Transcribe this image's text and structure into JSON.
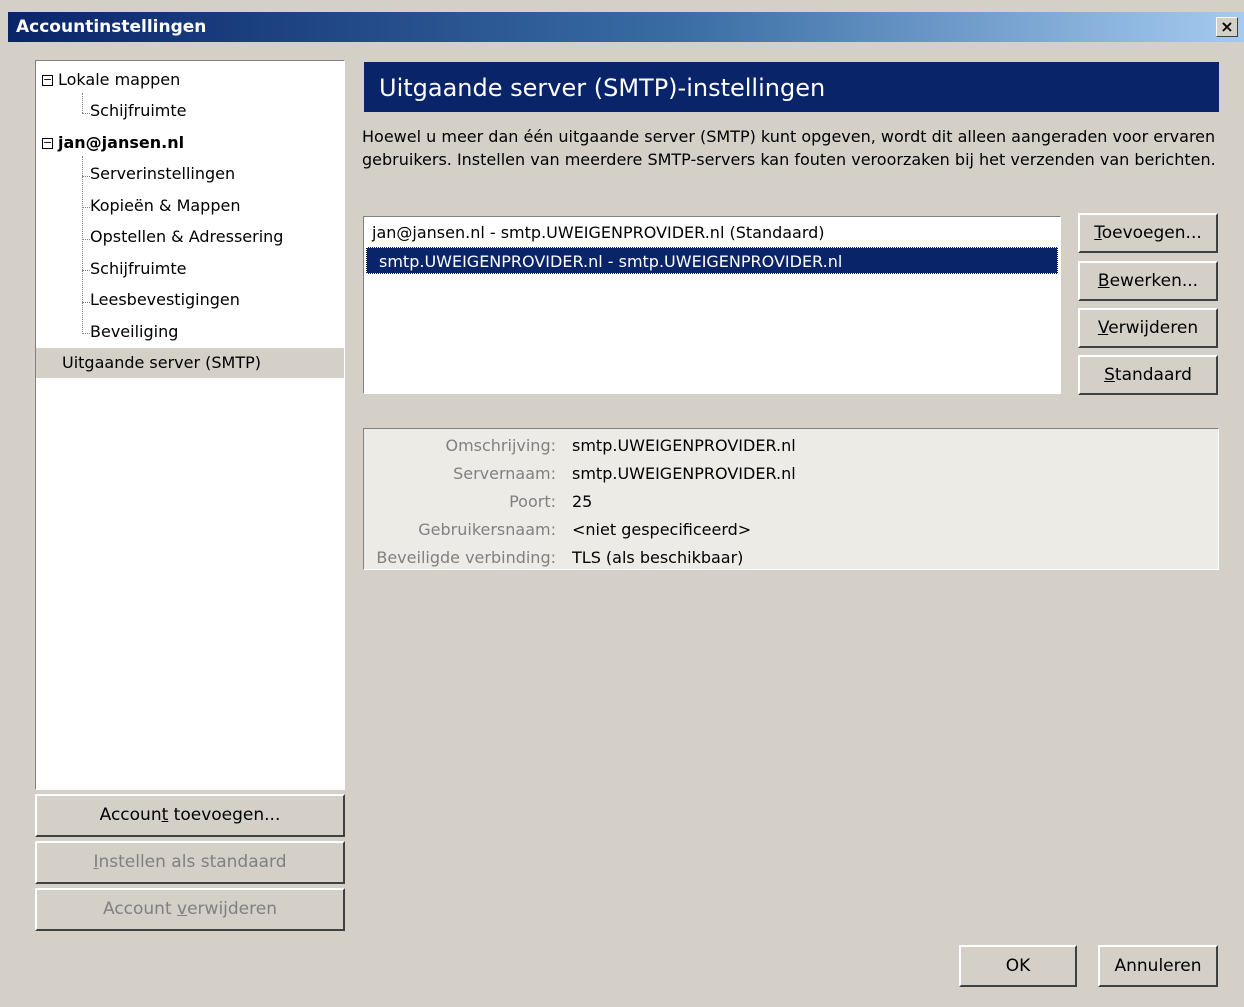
{
  "window": {
    "title": "Accountinstellingen",
    "close_label": "×"
  },
  "tree": {
    "items": [
      {
        "label": "Lokale mappen"
      },
      {
        "label": "Schijfruimte"
      },
      {
        "label": "jan@jansen.nl"
      },
      {
        "label": "Serverinstellingen"
      },
      {
        "label": "Kopieën & Mappen"
      },
      {
        "label": "Opstellen & Adressering"
      },
      {
        "label": "Schijfruimte"
      },
      {
        "label": "Leesbevestigingen"
      },
      {
        "label": "Beveiliging"
      },
      {
        "label": "Uitgaande server (SMTP)"
      }
    ]
  },
  "left_buttons": {
    "add_account": {
      "pre": "Accoun",
      "key": "t",
      "post": " toevoegen..."
    },
    "set_default": {
      "pre": "",
      "key": "I",
      "post": "nstellen als standaard"
    },
    "remove_account": {
      "pre": "Account ",
      "key": "v",
      "post": "erwijderen"
    }
  },
  "section": {
    "title": "Uitgaande server (SMTP)-instellingen",
    "description": "Hoewel u meer dan één uitgaande server (SMTP) kunt opgeven, wordt dit alleen aangeraden voor ervaren gebruikers. Instellen van meerdere SMTP-servers kan fouten veroorzaken bij het verzenden van berichten."
  },
  "servers": [
    {
      "label": "jan@jansen.nl - smtp.UWEIGENPROVIDER.nl (Standaard)"
    },
    {
      "label": "smtp.UWEIGENPROVIDER.nl - smtp.UWEIGENPROVIDER.nl"
    }
  ],
  "server_buttons": {
    "add": {
      "key": "T",
      "post": "oevoegen..."
    },
    "edit": {
      "key": "B",
      "post": "ewerken..."
    },
    "remove": {
      "key": "V",
      "post": "erwijderen"
    },
    "default": {
      "key": "S",
      "post": "tandaard"
    }
  },
  "details": [
    {
      "label": "Omschrijving:",
      "value": "smtp.UWEIGENPROVIDER.nl"
    },
    {
      "label": "Servernaam:",
      "value": "smtp.UWEIGENPROVIDER.nl"
    },
    {
      "label": "Poort:",
      "value": "25"
    },
    {
      "label": "Gebruikersnaam:",
      "value": "<niet gespecificeerd>"
    },
    {
      "label": "Beveiligde verbinding:",
      "value": "TLS (als beschikbaar)"
    }
  ],
  "dialog_buttons": {
    "ok": "OK",
    "cancel": "Annuleren"
  }
}
